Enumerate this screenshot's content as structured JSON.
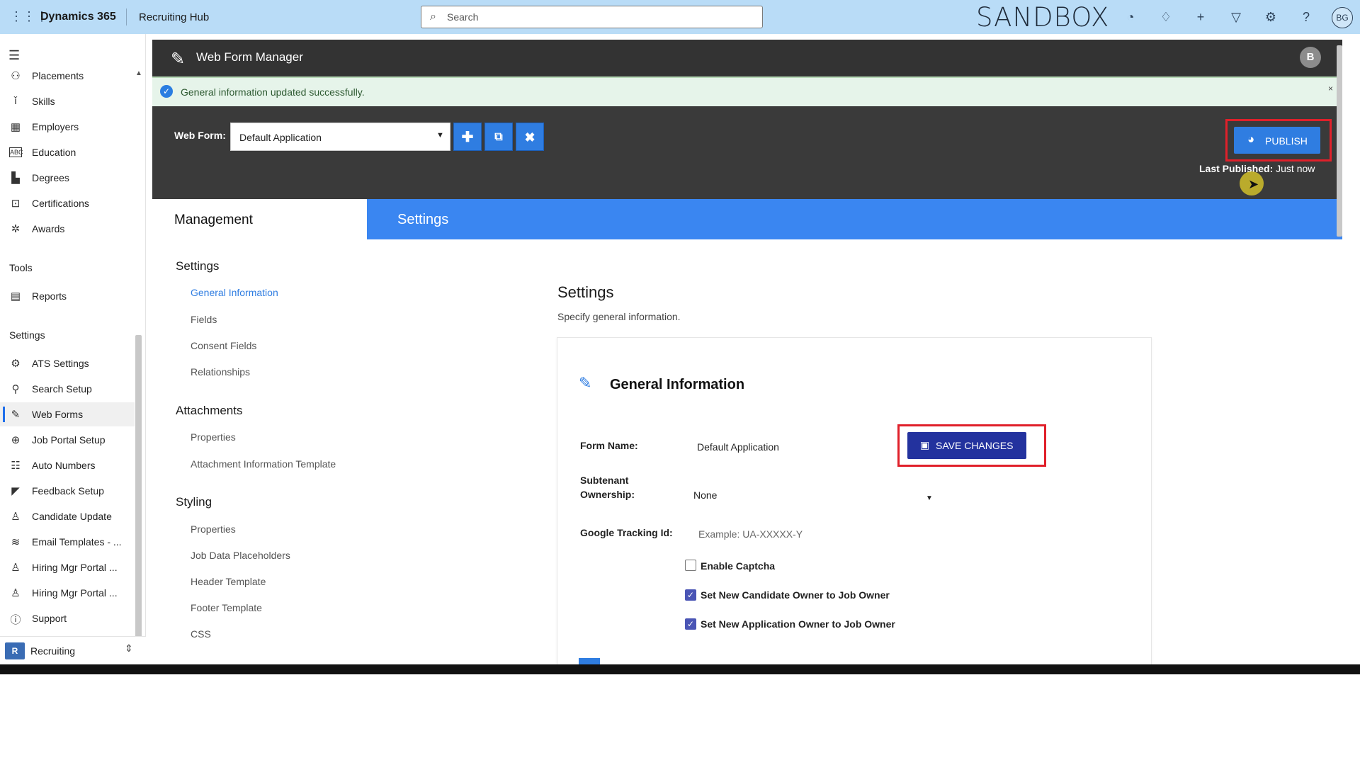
{
  "topbar": {
    "app_name": "Dynamics 365",
    "hub_name": "Recruiting Hub",
    "search_placeholder": "Search",
    "environment": "SANDBOX",
    "user_initials": "BG"
  },
  "leftnav": {
    "items_top": [
      {
        "label": "Placements",
        "icon": "placements-icon"
      },
      {
        "label": "Skills",
        "icon": "skills-icon"
      },
      {
        "label": "Employers",
        "icon": "employers-icon"
      },
      {
        "label": "Education",
        "icon": "education-icon"
      },
      {
        "label": "Degrees",
        "icon": "degrees-icon"
      },
      {
        "label": "Certifications",
        "icon": "certifications-icon"
      },
      {
        "label": "Awards",
        "icon": "awards-icon"
      }
    ],
    "tools_header": "Tools",
    "tools_items": [
      {
        "label": "Reports",
        "icon": "reports-icon"
      }
    ],
    "settings_header": "Settings",
    "settings_items": [
      {
        "label": "ATS Settings",
        "icon": "gear-icon"
      },
      {
        "label": "Search Setup",
        "icon": "search-setup-icon"
      },
      {
        "label": "Web Forms",
        "icon": "web-forms-icon",
        "active": true
      },
      {
        "label": "Job Portal Setup",
        "icon": "globe-icon"
      },
      {
        "label": "Auto Numbers",
        "icon": "numbered-list-icon"
      },
      {
        "label": "Feedback Setup",
        "icon": "feedback-icon"
      },
      {
        "label": "Candidate Update",
        "icon": "candidate-update-icon"
      },
      {
        "label": "Email Templates - ...",
        "icon": "layers-icon"
      },
      {
        "label": "Hiring Mgr Portal ...",
        "icon": "person-icon"
      },
      {
        "label": "Hiring Mgr Portal ...",
        "icon": "person-icon"
      },
      {
        "label": "Support",
        "icon": "help-icon"
      }
    ],
    "area": {
      "badge": "R",
      "label": "Recruiting"
    }
  },
  "wfm": {
    "title": "Web Form Manager",
    "user_badge": "B",
    "success_message": "General information updated successfully.",
    "close": "×",
    "web_form_label": "Web Form:",
    "web_form_value": "Default Application",
    "publish_label": "PUBLISH",
    "last_published_label": "Last Published:",
    "last_published_value": "Just now"
  },
  "tabs": {
    "management": "Management",
    "settings": "Settings"
  },
  "side_menu": {
    "settings_header": "Settings",
    "settings_links": [
      "General Information",
      "Fields",
      "Consent Fields",
      "Relationships"
    ],
    "attachments_header": "Attachments",
    "attachments_links": [
      "Properties",
      "Attachment Information Template"
    ],
    "styling_header": "Styling",
    "styling_links": [
      "Properties",
      "Job Data Placeholders",
      "Header Template",
      "Footer Template",
      "CSS"
    ]
  },
  "content": {
    "title": "Settings",
    "subtitle": "Specify general information.",
    "card_title": "General Information",
    "save_label": "SAVE CHANGES",
    "form_name_label": "Form Name:",
    "form_name_value": "Default Application",
    "subtenant_label_1": "Subtenant",
    "subtenant_label_2": "Ownership:",
    "subtenant_value": "None",
    "tracking_label": "Google Tracking Id:",
    "tracking_placeholder": "Example: UA-XXXXX-Y",
    "captcha_label": "Enable Captcha",
    "candidate_owner_label": "Set New Candidate Owner to Job Owner",
    "application_owner_label": "Set New Application Owner to Job Owner"
  },
  "colors": {
    "topbar": "#b9dcf7",
    "accent": "#2f7de1",
    "save_button": "#23329e",
    "highlight_outline": "#e0202a",
    "header_dark": "#333333"
  }
}
